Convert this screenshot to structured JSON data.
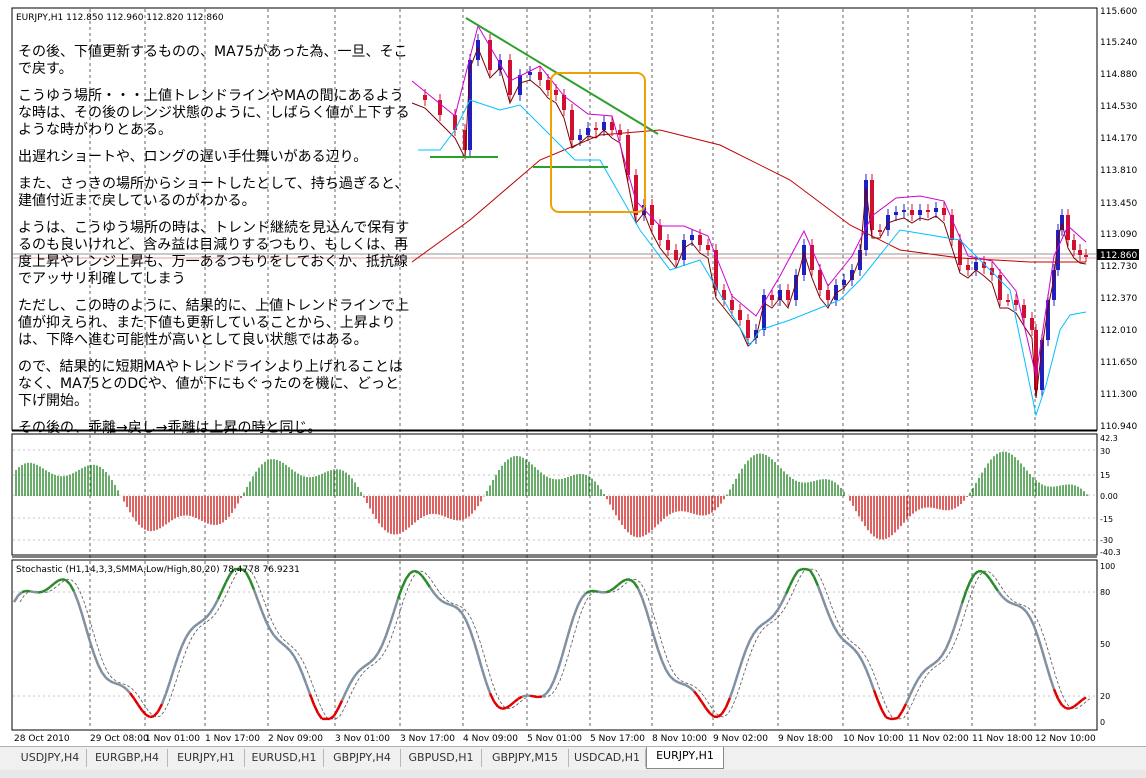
{
  "chart_header": "EURJPY,H1  112.850 112.960 112.820 112.860",
  "stoch_header": "Stochastic (H1,14,3,3,SMMA,Low/High,80,20) 78.4778 76.9231",
  "price_axis": [
    "115.600",
    "115.240",
    "114.880",
    "114.530",
    "114.170",
    "113.810",
    "113.450",
    "113.090",
    "112.730",
    "112.370",
    "112.010",
    "111.650",
    "111.300",
    "110.940"
  ],
  "current_price": "112.860",
  "osc_axis": [
    "42.3",
    "30",
    "15",
    "0.00",
    "-15",
    "-30",
    "-40.3"
  ],
  "stoch_axis": [
    "100",
    "80",
    "50",
    "20",
    "0"
  ],
  "time_axis": [
    "28 Oct 2010",
    "29 Oct 08:00",
    "1 Nov 01:00",
    "1 Nov 17:00",
    "2 Nov 09:00",
    "3 Nov 01:00",
    "3 Nov 17:00",
    "4 Nov 09:00",
    "5 Nov 01:00",
    "5 Nov 17:00",
    "8 Nov 10:00",
    "9 Nov 02:00",
    "9 Nov 18:00",
    "10 Nov 10:00",
    "11 Nov 02:00",
    "11 Nov 18:00",
    "12 Nov 10:00"
  ],
  "annotation": [
    "その後、下値更新するものの、MA75があった為、一旦、そこで戻す。",
    "こうゆう場所・・・上値トレンドラインやMAの間にあるような時は、その後のレンジ状態のように、しばらく値が上下するような時がわりとある。",
    "出遅れショートや、ロングの遅い手仕舞いがある辺り。",
    "また、さっきの場所からショートしたとして、持ち過ぎると、建値付近まで戻しているのがわかる。",
    "ようは、こうゆう場所の時は、トレンド継続を見込んで保有するのも良いけれど、含み益は目減りするつもり、もしくは、再度上昇やレンジ上昇も、万一あるつもりをしておくか、抵抗線でアッサリ利確してしまう",
    "ただし、この時のように、結果的に、上値トレンドラインで上値が抑えられ、また下値も更新していることから、上昇よりは、下降へ進む可能性が高いとして良い状態ではある。",
    "ので、結果的に短期MAやトレンドラインより上げれることはなく、MA75とのDCや、値が下にもぐったのを機に、どっと下げ開始。",
    "その後の、乖離→戻し→乖離は上昇の時と同じ。"
  ],
  "tabs": [
    "USDJPY,H4",
    "EURGBP,H4",
    "EURJPY,H1",
    "EURUSD,H1",
    "GBPJPY,H4",
    "GBPUSD,H1",
    "GBPJPY,M15",
    "USDCAD,H1",
    "EURJPY,H1"
  ],
  "active_tab_index": 8,
  "status_text": "",
  "colors": {
    "bull_candle": "#2020c0",
    "bear_candle": "#d01030",
    "trendline": "#2ca02c",
    "highlight_box": "#f0a000",
    "ma_long": "#c00000",
    "ma_short": "#7a0000",
    "envelope": "#d000d0",
    "stop_line": "#00c0ff",
    "stoch_main": "#8090a0",
    "stoch_over": "#2a8a2a",
    "stoch_under": "#e00000",
    "osc_pos": "#2a8a2a",
    "osc_neg": "#d02020"
  }
}
